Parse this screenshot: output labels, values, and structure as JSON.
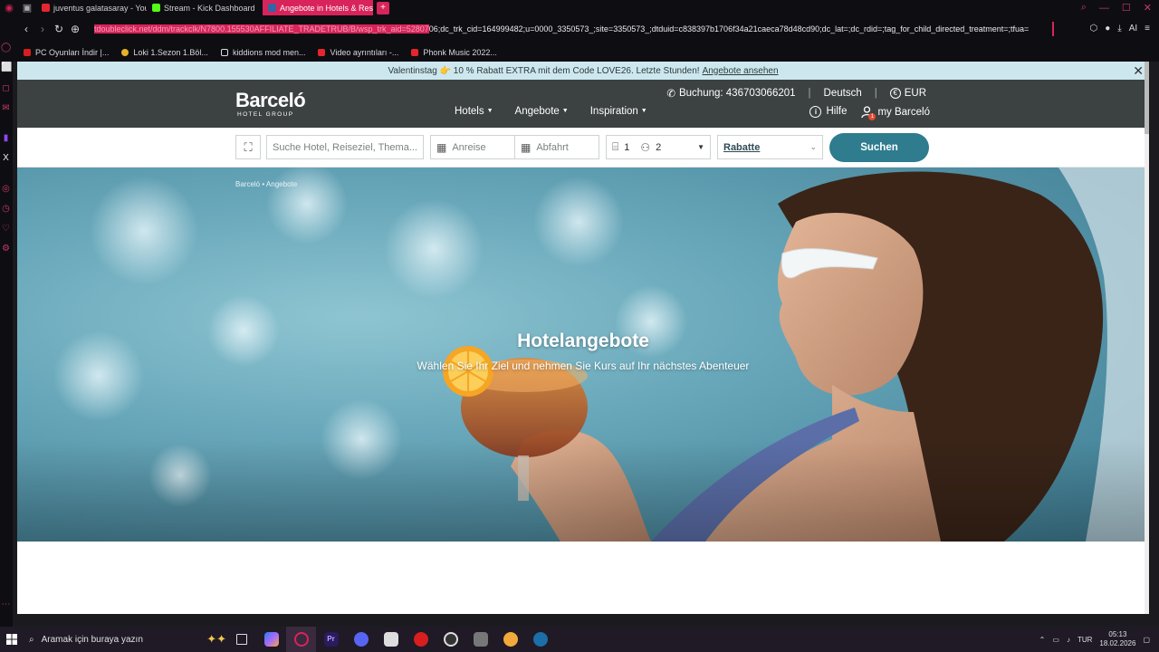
{
  "browser": {
    "tabs": [
      {
        "label": "juventus galatasaray - You",
        "color": "#e5262f"
      },
      {
        "label": "Stream - Kick Dashboard",
        "color": "#53fc18"
      },
      {
        "label": "Angebote in Hotels & Reso",
        "color": "#3465a4"
      }
    ],
    "new_tab": "+",
    "url_selected": "tdoubleclick.net/ddm/trackclk/N7800.155530AFFILIATE_TRADETRUB/B/wsp_trk_aid=52807",
    "url_rest": "06;dc_trk_cid=164999482;u=0000_3350573_;site=3350573_;dtduid=c838397b1706f34a21caeca78d48cd90;dc_lat=;dc_rdid=;tag_for_child_directed_treatment=;tfua=",
    "bookmarks": [
      {
        "label": "PC Oyunları İndir |...",
        "color": "#d81e1e"
      },
      {
        "label": "Loki 1.Sezon 1.Böl...",
        "color": "#e8b12a"
      },
      {
        "label": "kiddions mod men...",
        "color": "#ffffff"
      },
      {
        "label": "Video ayrıntıları -...",
        "color": "#e5262f"
      },
      {
        "label": "Phonk Music 2022...",
        "color": "#e5262f"
      }
    ]
  },
  "promo": {
    "text": "Valentinstag 👉 10 % Rabatt EXTRA mit dem Code LOVE26. Letzte Stunden!",
    "link": "Angebote ansehen"
  },
  "header": {
    "logo_name": "Barceló",
    "logo_sub": "HOTEL GROUP",
    "phone": "Buchung: 436703066201",
    "language": "Deutsch",
    "currency": "EUR",
    "nav": [
      "Hotels",
      "Angebote",
      "Inspiration"
    ],
    "help": "Hilfe",
    "account": "my Barceló",
    "account_badge": "1"
  },
  "search": {
    "placeholder": "Suche Hotel, Reiseziel, Thema...",
    "checkin": "Anreise",
    "checkout": "Abfahrt",
    "rooms": "1",
    "guests": "2",
    "rate": "Rabatte",
    "button": "Suchen"
  },
  "hero": {
    "breadcrumb": "Barceló • Angebote",
    "title": "Hotelangebote",
    "subtitle": "Wählen Sie Ihr Ziel und nehmen Sie Kurs auf Ihr nächstes Abenteuer"
  },
  "taskbar": {
    "search_placeholder": "Aramak için buraya yazın",
    "language": "TUR",
    "time": "05:13",
    "date": "18.02.2026",
    "apps": [
      "#2b7de9",
      "#a46bff",
      "#d8245a",
      "#9999ff",
      "#5865f2",
      "#f0c419",
      "#d81e1e",
      "#3b3b3b",
      "#888888",
      "#f2a93b",
      "#2d9cdb"
    ]
  }
}
